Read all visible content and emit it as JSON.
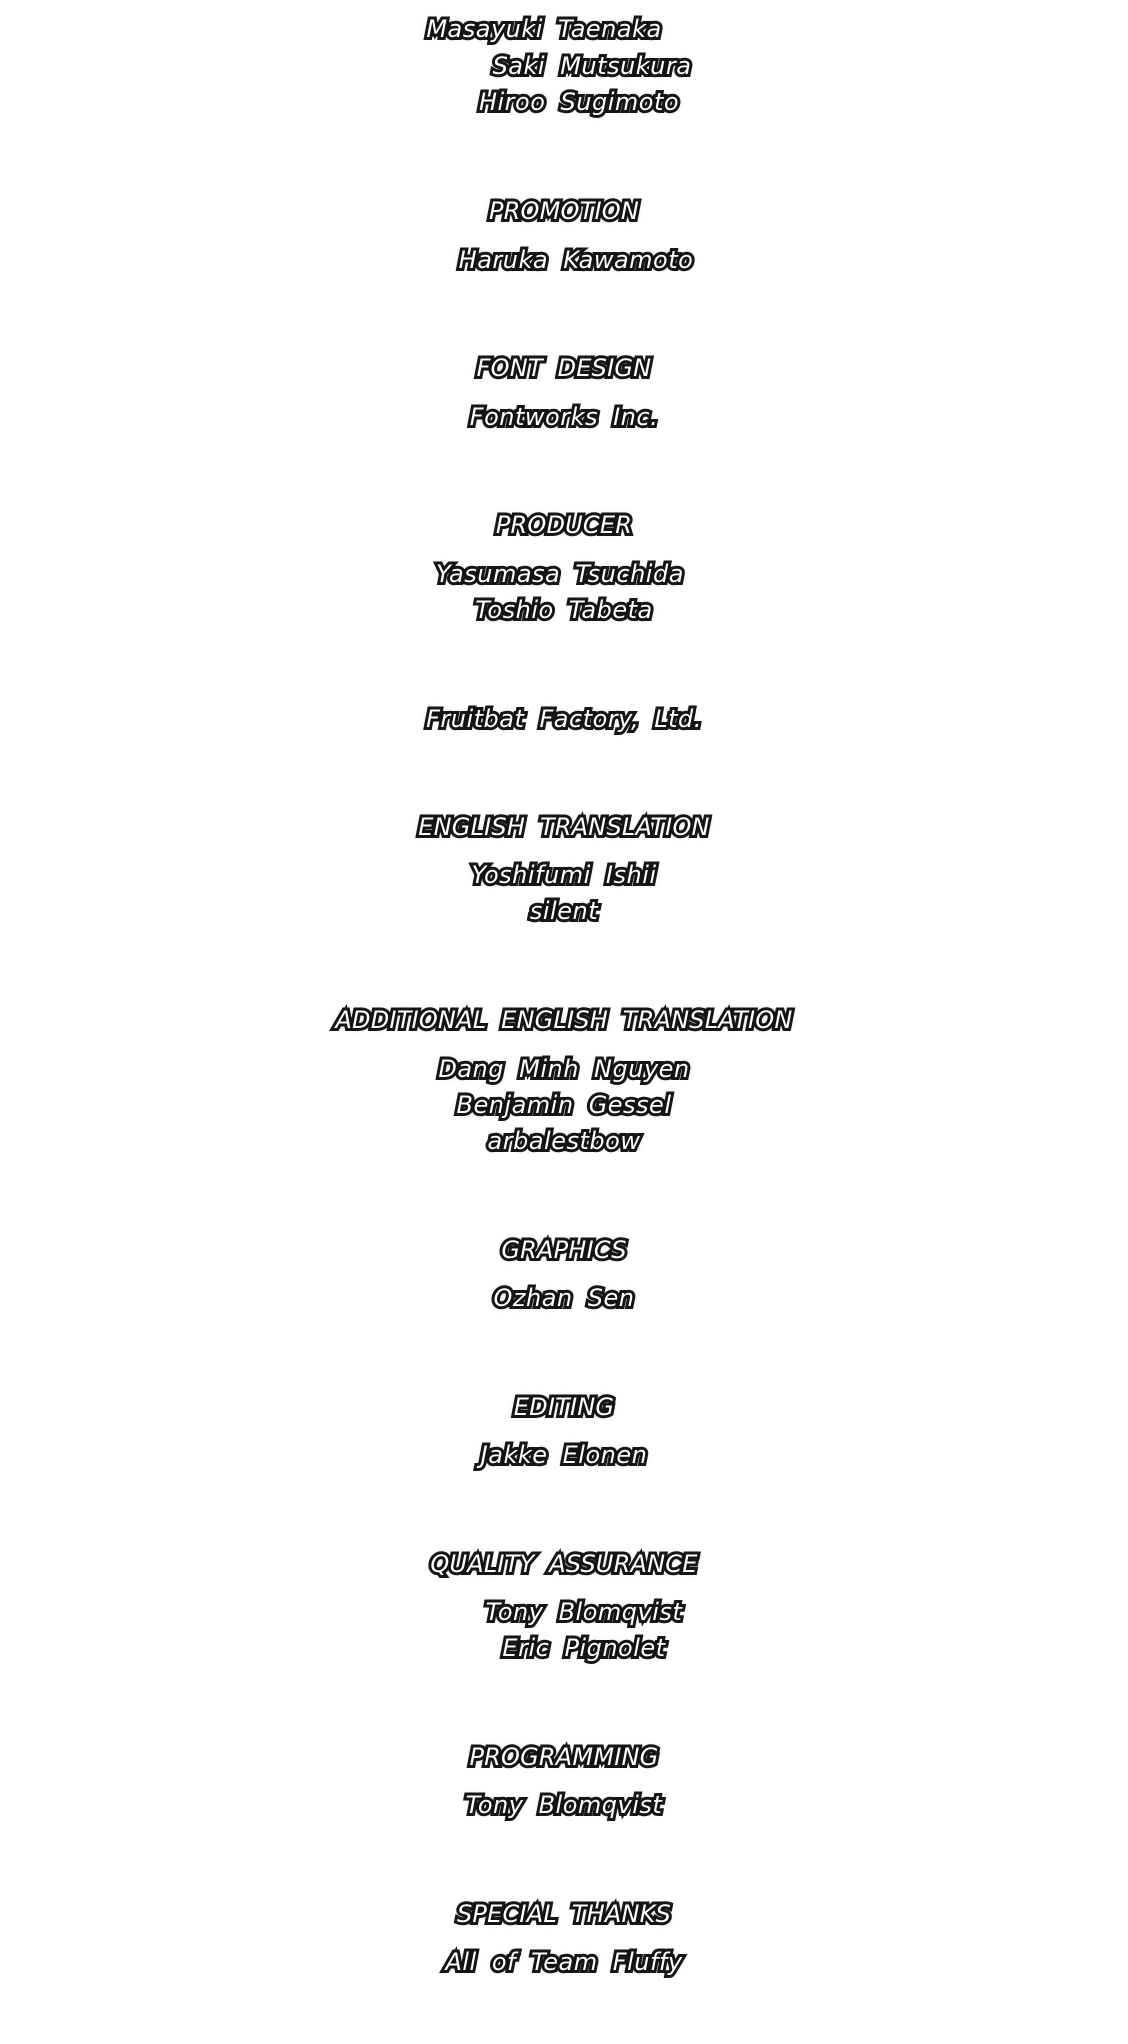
{
  "credits": {
    "staff_continued": {
      "names": [
        "Masayuki Taenaka",
        "Saki Mutsukura",
        "Hiroo Sugimoto"
      ]
    },
    "promotion": {
      "heading": "PROMOTION",
      "names": [
        "Haruka Kawamoto"
      ]
    },
    "font_design": {
      "heading": "FONT DESIGN",
      "names": [
        "Fontworks Inc."
      ]
    },
    "producer": {
      "heading": "PRODUCER",
      "names": [
        "Yasumasa Tsuchida",
        "Toshio Tabeta"
      ]
    },
    "company": {
      "names": [
        "Fruitbat Factory, Ltd."
      ]
    },
    "english_translation": {
      "heading": "ENGLISH TRANSLATION",
      "names": [
        "Yoshifumi Ishii",
        "silent"
      ]
    },
    "additional_english_translation": {
      "heading": "ADDITIONAL ENGLISH TRANSLATION",
      "names": [
        "Dang Minh Nguyen",
        "Benjamin Gessel",
        "arbalestbow"
      ]
    },
    "graphics": {
      "heading": "GRAPHICS",
      "names": [
        "Ozhan Sen"
      ]
    },
    "editing": {
      "heading": "EDITING",
      "names": [
        "Jakke Elonen"
      ]
    },
    "quality_assurance": {
      "heading": "QUALITY ASSURANCE",
      "names": [
        "Tony Blomqvist",
        "Eric Pignolet"
      ]
    },
    "programming": {
      "heading": "PROGRAMMING",
      "names": [
        "Tony Blomqvist"
      ]
    },
    "special_thanks": {
      "heading": "SPECIAL THANKS",
      "names": [
        "All of Team Fluffy"
      ]
    }
  },
  "colors": {
    "text_fill": "#ffffff",
    "text_outline": "#1a1a1a",
    "background": "#ffffff"
  }
}
